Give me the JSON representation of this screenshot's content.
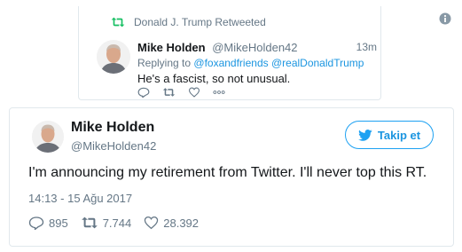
{
  "retweet": {
    "header": "Donald J. Trump Retweeted",
    "name": "Mike Holden",
    "handle": "@MikeHolden42",
    "time": "13m",
    "reply_prefix": "Replying to",
    "reply_mentions": [
      "@foxandfriends",
      "@realDonaldTrump"
    ],
    "body": "He's a fascist, so not unusual."
  },
  "tweet": {
    "name": "Mike Holden",
    "handle": "@MikeHolden42",
    "follow_label": "Takip et",
    "text": "I'm announcing my retirement from Twitter. I'll never top this RT.",
    "timestamp": "14:13 - 15 Ağu 2017",
    "replies": "895",
    "retweets": "7.744",
    "likes": "28.392"
  },
  "colors": {
    "twitter_blue": "#1da1f2",
    "link_blue": "#1b95e0",
    "retweet_green": "#17bf63",
    "muted_gray": "#657786",
    "border": "#e1e8ed"
  },
  "icons": {
    "retweet_header": "retweet-icon",
    "info": "info-icon",
    "follow_bird": "bird-icon",
    "reply": "reply-icon",
    "retweet": "retweet-icon",
    "like": "heart-icon",
    "more": "more-dots-icon"
  }
}
